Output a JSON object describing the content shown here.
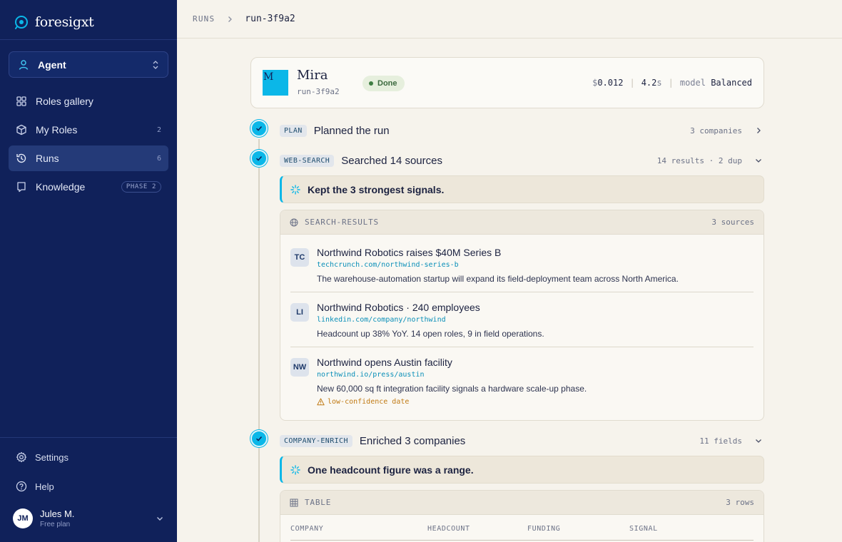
{
  "brand": {
    "name": "foresigxt",
    "accent": "#0bb7e8",
    "sidebar_bg": "#10215a"
  },
  "sidebar": {
    "agent_select": {
      "label": "Agent"
    },
    "nav": [
      {
        "label": "Roles gallery",
        "icon": "grid-icon"
      },
      {
        "label": "My Roles",
        "count": "2",
        "icon": "cube-icon"
      },
      {
        "label": "Runs",
        "count": "6",
        "icon": "history-icon",
        "active": true
      },
      {
        "label": "Knowledge",
        "badge": "PHASE 2",
        "icon": "book-icon"
      }
    ],
    "footer": [
      {
        "label": "Settings",
        "icon": "gear-icon"
      },
      {
        "label": "Help",
        "icon": "help-icon"
      }
    ],
    "user": {
      "initials": "JM",
      "name": "Jules M.",
      "plan": "Free plan"
    }
  },
  "breadcrumb": {
    "root": "RUNS",
    "current": "run-3f9a2"
  },
  "run": {
    "avatar_letter": "M",
    "name": "Mira",
    "id": "run-3f9a2",
    "status": "Done",
    "cost_symbol": "$",
    "cost": "0.012",
    "duration": "4.2",
    "duration_unit": "s",
    "model_label": "model",
    "model": "Balanced"
  },
  "steps": [
    {
      "tag": "PLAN",
      "title": "Planned the run",
      "meta": "3 companies",
      "expanded": false
    },
    {
      "tag": "WEB-SEARCH",
      "title": "Searched 14 sources",
      "meta": "14 results · 2 dup",
      "expanded": true,
      "note": "Kept the 3 strongest signals.",
      "panel": {
        "title": "SEARCH-RESULTS",
        "count": "3 sources",
        "sources": [
          {
            "icon": "TC",
            "title": "Northwind Robotics raises $40M Series B",
            "url": "techcrunch.com/northwind-series-b",
            "desc": "The warehouse-automation startup will expand its field-deployment team across North America."
          },
          {
            "icon": "LI",
            "title": "Northwind Robotics · 240 employees",
            "url": "linkedin.com/company/northwind",
            "desc": "Headcount up 38% YoY. 14 open roles, 9 in field operations."
          },
          {
            "icon": "NW",
            "title": "Northwind opens Austin facility",
            "url": "northwind.io/press/austin",
            "desc": "New 60,000 sq ft integration facility signals a hardware scale-up phase.",
            "warning": "low-confidence date"
          }
        ]
      }
    },
    {
      "tag": "COMPANY-ENRICH",
      "title": "Enriched 3 companies",
      "meta": "11 fields",
      "expanded": true,
      "note": "One headcount figure was a range.",
      "panel": {
        "title": "TABLE",
        "count": "3 rows",
        "columns": [
          "COMPANY",
          "HEADCOUNT",
          "FUNDING",
          "SIGNAL"
        ]
      }
    }
  ]
}
